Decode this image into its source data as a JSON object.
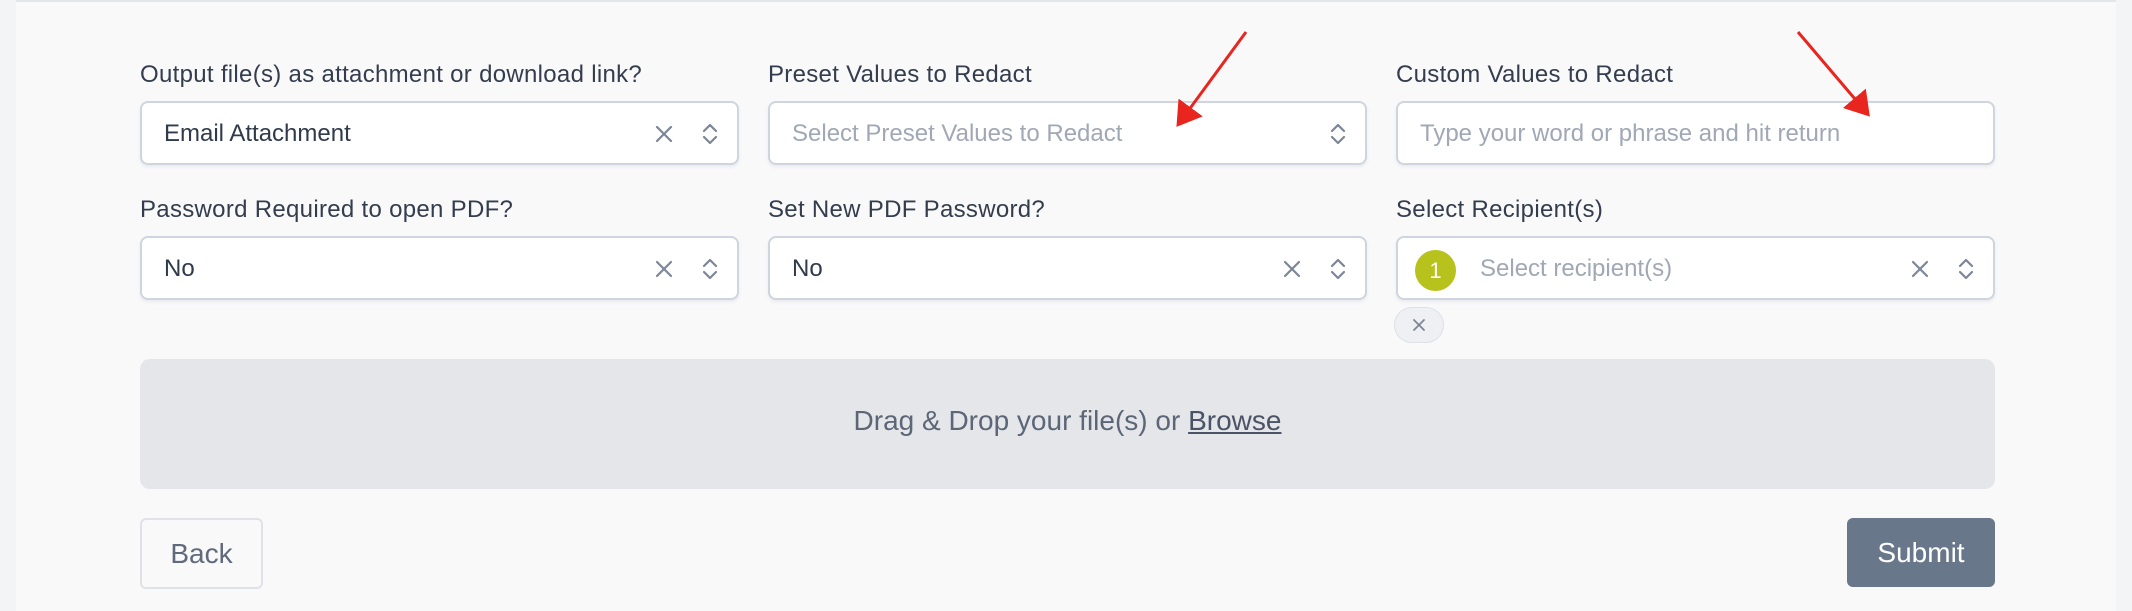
{
  "form": {
    "output_label": "Output file(s) as attachment or download link?",
    "output_value": "Email Attachment",
    "preset_label": "Preset Values to Redact",
    "preset_placeholder": "Select Preset Values to Redact",
    "custom_label": "Custom Values to Redact",
    "custom_placeholder": "Type your word or phrase and hit return",
    "password_required_label": "Password Required to open PDF?",
    "password_required_value": "No",
    "new_password_label": "Set New PDF Password?",
    "new_password_value": "No",
    "recipients_label": "Select Recipient(s)",
    "recipients_placeholder": "Select recipient(s)",
    "recipients_count": "1"
  },
  "dropzone": {
    "text": "Drag & Drop your file(s) or",
    "browse": "Browse"
  },
  "actions": {
    "back": "Back",
    "submit": "Submit"
  },
  "colors": {
    "annotation_arrow": "#e8251f",
    "badge": "#b8c21c",
    "submit_bg": "#69778a"
  }
}
